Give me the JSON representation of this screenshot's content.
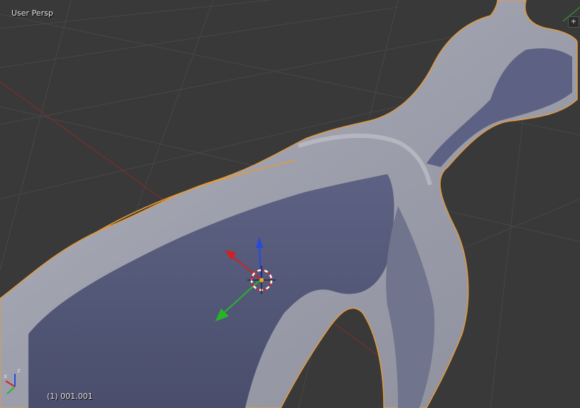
{
  "viewport": {
    "view_name": "User Persp",
    "frame_info": "(1) 001.001",
    "colors": {
      "background": "#393939",
      "grid": "#474747",
      "x_axis": "#8a2a2a",
      "mesh_light": "#a9a9b4",
      "mesh_shadow": "#565a78",
      "selection_outline": "#e39a3c"
    }
  },
  "gizmo": {
    "x_arrow_color": "#d42020",
    "y_arrow_color": "#28b428",
    "z_arrow_color": "#2848e0",
    "cursor_icon": "3d-cursor-icon"
  },
  "axis_widget": {
    "x_label": "x",
    "z_label": "z"
  },
  "corner_widget": {
    "icon": "plus-icon",
    "glyph": "+"
  }
}
